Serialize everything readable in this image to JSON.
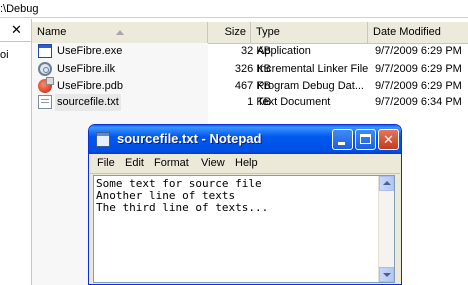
{
  "explorer": {
    "address": ":\\Debug",
    "left_pane_fragment": "oi",
    "columns": {
      "name": "Name",
      "size": "Size",
      "type": "Type",
      "date": "Date Modified"
    },
    "files": [
      {
        "name": "UseFibre.exe",
        "size": "32 KB",
        "type": "Application",
        "date": "9/7/2009 6:29 PM",
        "icon": "exe-icon"
      },
      {
        "name": "UseFibre.ilk",
        "size": "326 KB",
        "type": "Incremental Linker File",
        "date": "9/7/2009 6:29 PM",
        "icon": "ilk-icon"
      },
      {
        "name": "UseFibre.pdb",
        "size": "467 KB",
        "type": "Program Debug Dat...",
        "date": "9/7/2009 6:29 PM",
        "icon": "pdb-icon"
      },
      {
        "name": "sourcefile.txt",
        "size": "1 KB",
        "type": "Text Document",
        "date": "9/7/2009 6:34 PM",
        "icon": "text-file-icon"
      }
    ]
  },
  "notepad": {
    "title": "sourcefile.txt - Notepad",
    "menu": [
      "File",
      "Edit",
      "Format",
      "View",
      "Help"
    ],
    "content": "Some text for source file\nAnother line of texts\nThe third line of texts..."
  }
}
